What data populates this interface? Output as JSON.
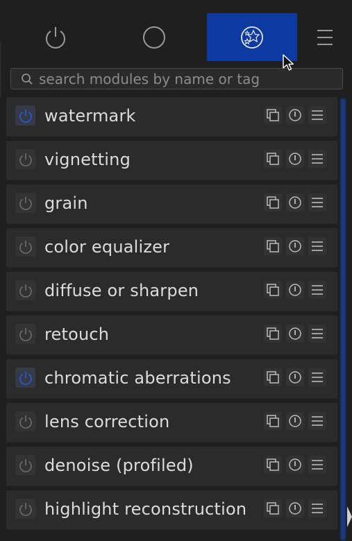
{
  "tabs": [
    {
      "icon": "power-icon",
      "active": false
    },
    {
      "icon": "circle-icon",
      "active": false
    },
    {
      "icon": "stars-icon",
      "active": true
    },
    {
      "icon": "hamburger-menu-icon",
      "active": false
    }
  ],
  "colors": {
    "accent": "#0c3aa0",
    "active_power": "#2a5bd7",
    "inactive_power": "#6e6e6e",
    "panel": "#2b2b2b",
    "background": "#1f1f1f"
  },
  "search": {
    "placeholder": "search modules by name or tag",
    "value": ""
  },
  "modules": [
    {
      "name": "watermark",
      "enabled": true
    },
    {
      "name": "vignetting",
      "enabled": false
    },
    {
      "name": "grain",
      "enabled": false
    },
    {
      "name": "color equalizer",
      "enabled": false
    },
    {
      "name": "diffuse or sharpen",
      "enabled": false
    },
    {
      "name": "retouch",
      "enabled": false
    },
    {
      "name": "chromatic aberrations",
      "enabled": true
    },
    {
      "name": "lens correction",
      "enabled": false
    },
    {
      "name": "denoise (profiled)",
      "enabled": false
    },
    {
      "name": "highlight reconstruction",
      "enabled": false
    }
  ],
  "module_buttons": [
    "multi-instance-icon",
    "reset-icon",
    "presets-icon"
  ]
}
